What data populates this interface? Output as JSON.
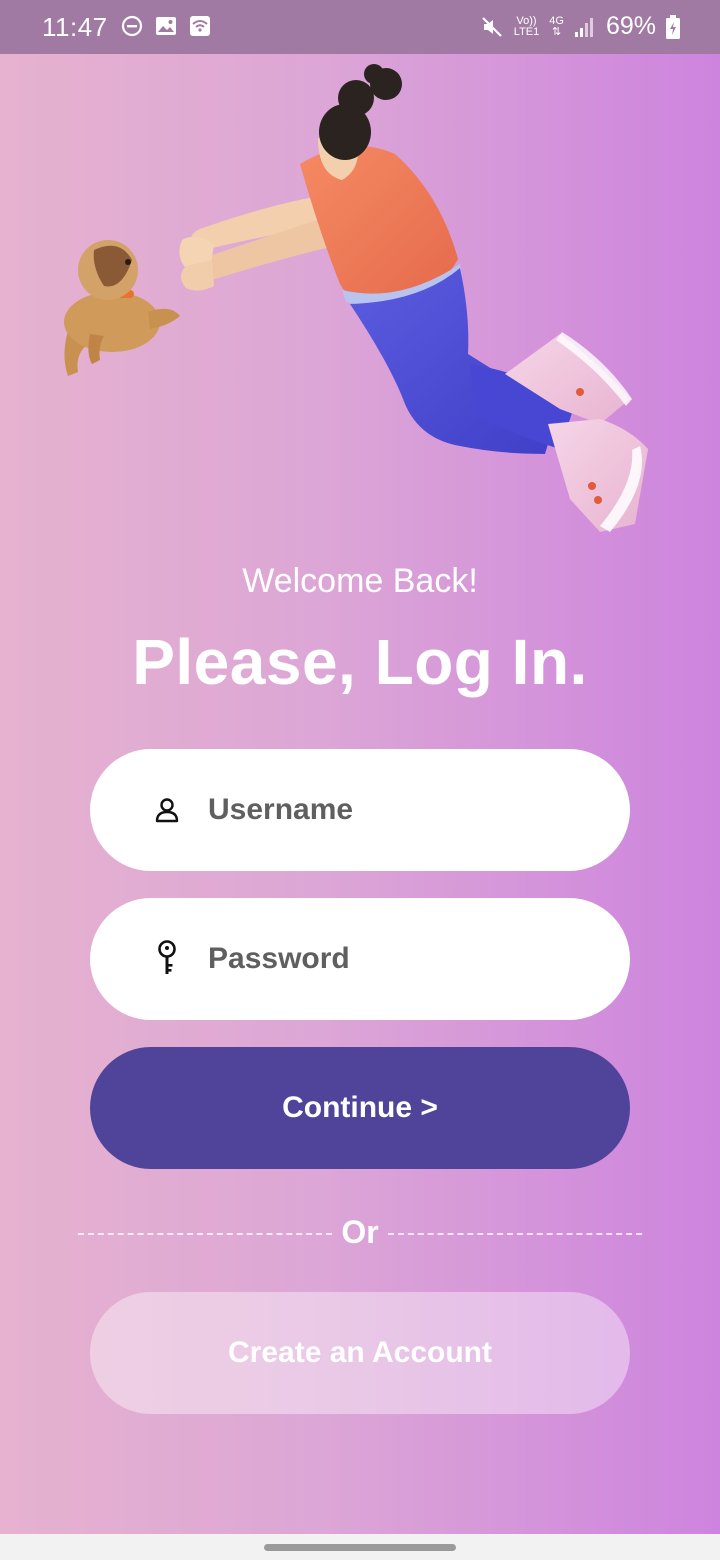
{
  "status_bar": {
    "time": "11:47",
    "left_icons": [
      "do-not-disturb-icon",
      "image-icon",
      "wifi-calling-icon"
    ],
    "network_volte": "Vo))",
    "network_lte": "LTE1",
    "network_4g": "4G",
    "battery": "69%",
    "right_icons": [
      "mute-icon",
      "signal-icon",
      "battery-icon"
    ]
  },
  "illustration": {
    "icon": "girl-chasing-dog-illustration"
  },
  "login": {
    "welcome": "Welcome Back!",
    "title": "Please, Log In.",
    "username_placeholder": "Username",
    "password_placeholder": "Password",
    "continue_label": "Continue >",
    "or_label": "Or",
    "create_account_label": "Create an Account"
  },
  "colors": {
    "accent": "#50449a",
    "gradient_left": "#e6b2cf",
    "gradient_right": "#cd84de"
  }
}
